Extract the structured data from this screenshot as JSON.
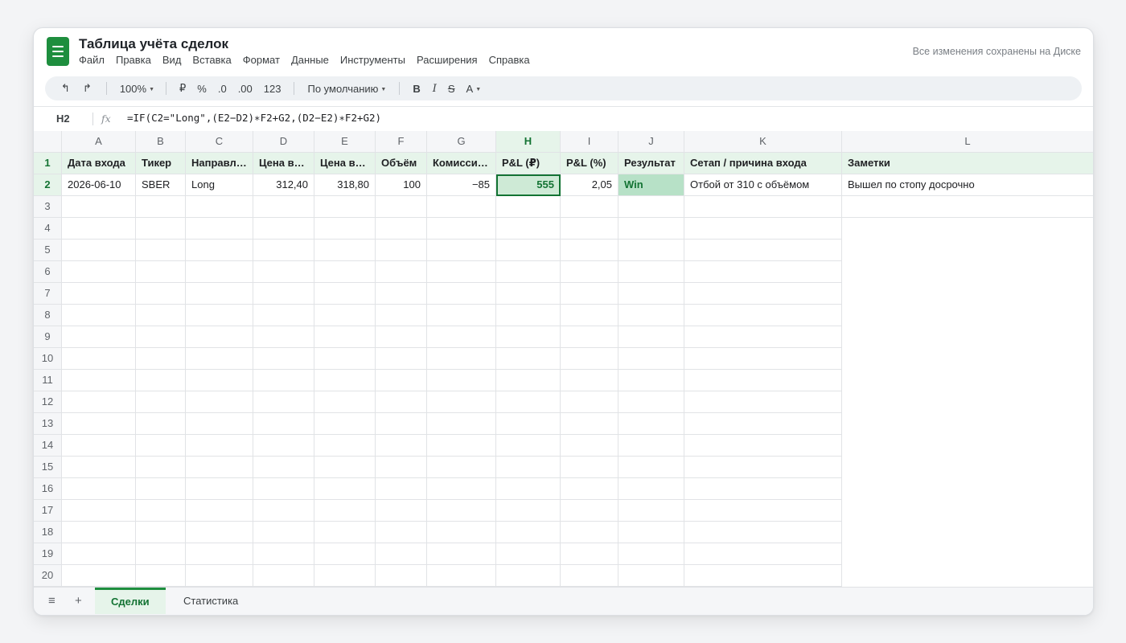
{
  "app": {
    "title": "Таблица учёта сделок",
    "save_status": "Все изменения сохранены на Диске",
    "menu": [
      "Файл",
      "Правка",
      "Вид",
      "Вставка",
      "Формат",
      "Данные",
      "Инструменты",
      "Расширения",
      "Справка"
    ]
  },
  "toolbar": {
    "undo": "↰",
    "redo": "↱",
    "zoom": "100%",
    "currency": "₽",
    "percent": "%",
    "decrease_decimals": ".0",
    "increase_decimals": ".00",
    "number_format": "123",
    "font": "По умолчанию",
    "bold": "B",
    "italic": "I",
    "strike": "S",
    "text_color": "A"
  },
  "formula_bar": {
    "cell_ref": "H2",
    "fx": "fx",
    "formula": "=IF(C2=\"Long\",(E2−D2)∗F2+G2,(D2−E2)∗F2+G2)"
  },
  "grid": {
    "columns": [
      "A",
      "B",
      "C",
      "D",
      "E",
      "F",
      "G",
      "H",
      "I",
      "J",
      "K",
      "L"
    ],
    "active_column": "H",
    "active_row": 2,
    "rows": [
      [
        "Дата входа",
        "Тикер",
        "Направл…",
        "Цена в…",
        "Цена в…",
        "Объём",
        "Комисси…",
        "P&L (₽)",
        "P&L (%)",
        "Результат",
        "Сетап / причина входа",
        "Заметки"
      ],
      [
        "2026-06-10",
        "SBER",
        "Long",
        "312,40",
        "318,80",
        "100",
        "−85",
        "555",
        "2,05",
        "Win",
        "Отбой от 310 с объёмом",
        "Вышел по стопу досрочно"
      ]
    ],
    "row_numbers": [
      "1",
      "2",
      "3",
      "4",
      "5",
      "6",
      "7",
      "8",
      "9",
      "10",
      "11",
      "12",
      "13",
      "14",
      "15",
      "16",
      "17",
      "18",
      "19",
      "20"
    ]
  },
  "sheets": {
    "tabs": [
      "Сделки",
      "Статистика"
    ],
    "active": "Сделки"
  },
  "colors": {
    "accent": "#1e8e3e",
    "header_fill": "#e6f4ea",
    "win_fill": "#b7e1c7"
  }
}
